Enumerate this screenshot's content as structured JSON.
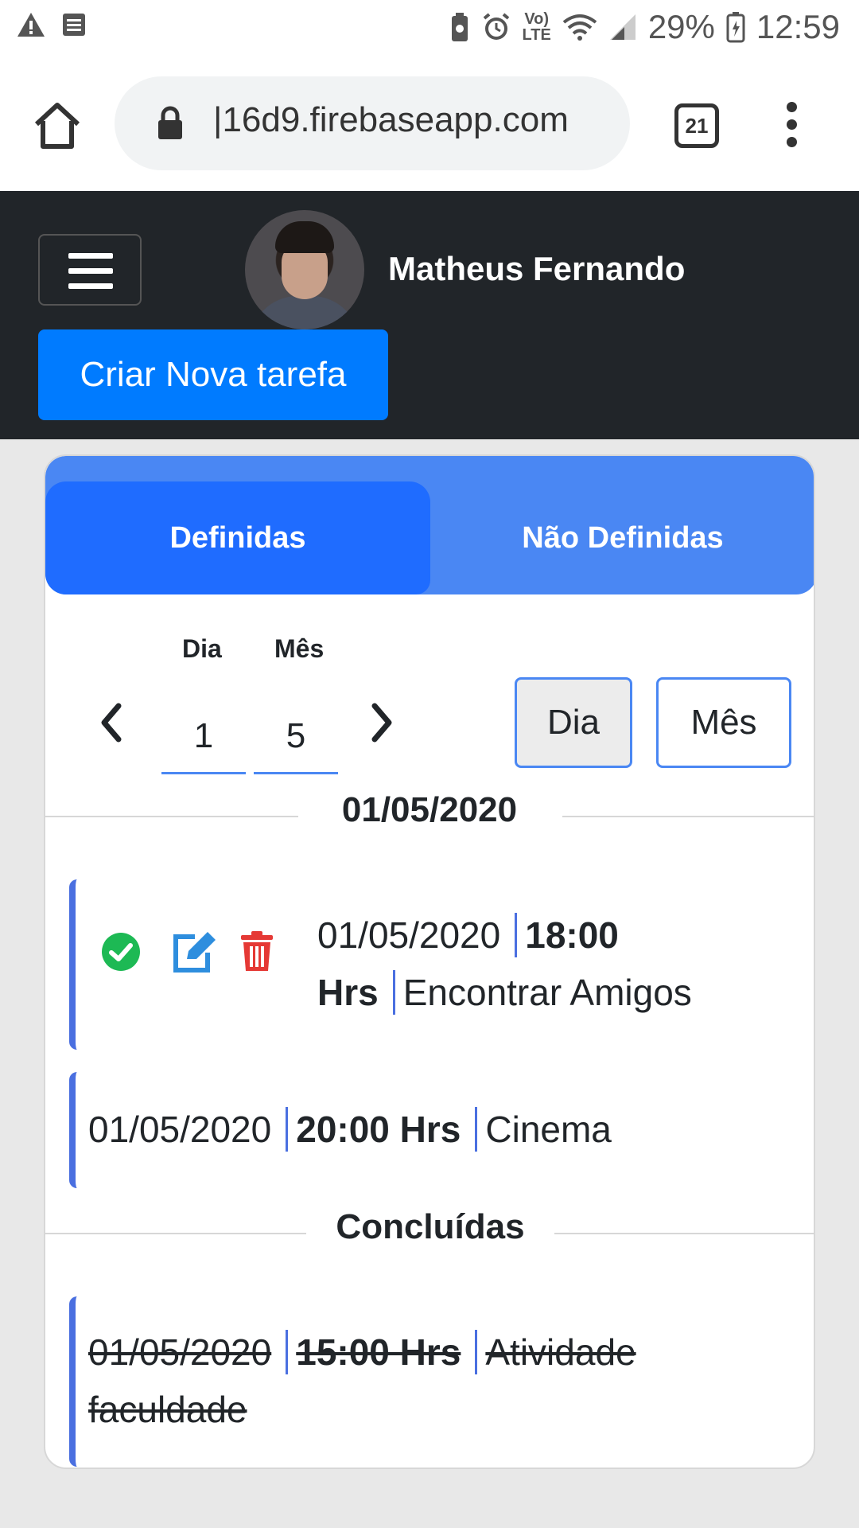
{
  "status_bar": {
    "battery_percent": "29%",
    "time": "12:59",
    "network_label": "LTE"
  },
  "browser": {
    "url": "16d9.firebaseapp.com",
    "tab_count": "21"
  },
  "app_nav": {
    "user_name": "Matheus Fernando",
    "new_task_button": "Criar Nova tarefa"
  },
  "tabs": [
    {
      "label": "Definidas",
      "active": true
    },
    {
      "label": "Não Definidas",
      "active": false
    }
  ],
  "date_picker": {
    "day_label": "Dia",
    "month_label": "Mês",
    "day_value": "1",
    "month_value": "5",
    "view_day_button": "Dia",
    "view_month_button": "Mês"
  },
  "section_date": "01/05/2020",
  "tasks": [
    {
      "date": "01/05/2020",
      "time": "18:00",
      "time_unit": "Hrs",
      "title": "Encontrar Amigos"
    },
    {
      "date": "01/05/2020",
      "time": "20:00 Hrs",
      "title": "Cinema"
    }
  ],
  "completed_section": "Concluídas",
  "completed_tasks": [
    {
      "date": "01/05/2020",
      "time": "15:00 Hrs",
      "title_line1": "Atividade",
      "title_line2": "faculdade"
    }
  ],
  "colors": {
    "nav_bg": "#212529",
    "primary": "#007bff",
    "tab_bg": "#4a87f3",
    "tab_active": "#1f6cff",
    "task_border": "#4a6fe0",
    "check": "#1db954",
    "edit": "#2e8ede",
    "delete": "#e53935"
  }
}
